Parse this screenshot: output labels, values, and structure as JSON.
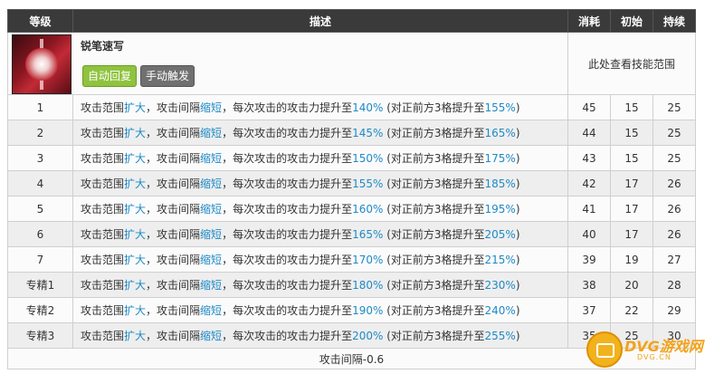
{
  "skill": {
    "name": "锐笔速写",
    "tags": [
      "自动回复",
      "手动触发"
    ],
    "range_link": "此处查看技能范围"
  },
  "table": {
    "headers": [
      "等级",
      "描述",
      "消耗",
      "初始",
      "持续"
    ],
    "desc_parts": {
      "p1": "攻击范围",
      "h1": "扩大",
      "p2": "，攻击间隔",
      "h2": "缩短",
      "p3": "，每次攻击的攻击力提升至",
      "p4": " (对正前方3格提升至",
      "p5": ")"
    },
    "rows": [
      {
        "level": "1",
        "atk": "140%",
        "front": "155%",
        "cost": "45",
        "init": "15",
        "dur": "25"
      },
      {
        "level": "2",
        "atk": "145%",
        "front": "165%",
        "cost": "44",
        "init": "15",
        "dur": "25"
      },
      {
        "level": "3",
        "atk": "150%",
        "front": "175%",
        "cost": "43",
        "init": "15",
        "dur": "25"
      },
      {
        "level": "4",
        "atk": "155%",
        "front": "185%",
        "cost": "42",
        "init": "17",
        "dur": "26"
      },
      {
        "level": "5",
        "atk": "160%",
        "front": "195%",
        "cost": "41",
        "init": "17",
        "dur": "26"
      },
      {
        "level": "6",
        "atk": "165%",
        "front": "205%",
        "cost": "40",
        "init": "17",
        "dur": "26"
      },
      {
        "level": "7",
        "atk": "170%",
        "front": "215%",
        "cost": "39",
        "init": "19",
        "dur": "27"
      },
      {
        "level": "专精1",
        "atk": "180%",
        "front": "230%",
        "cost": "38",
        "init": "20",
        "dur": "28"
      },
      {
        "level": "专精2",
        "atk": "190%",
        "front": "240%",
        "cost": "37",
        "init": "22",
        "dur": "29"
      },
      {
        "level": "专精3",
        "atk": "200%",
        "front": "255%",
        "cost": "35",
        "init": "25",
        "dur": "30"
      }
    ],
    "footer": "攻击间隔-0.6"
  },
  "watermark": {
    "text": "DVG游戏网",
    "sub": "DVG.CN"
  },
  "colors": {
    "header_bg": "#3a3a3a",
    "highlight": "#1f8ac6",
    "tag_green": "#8fc33f",
    "tag_gray": "#707070"
  }
}
